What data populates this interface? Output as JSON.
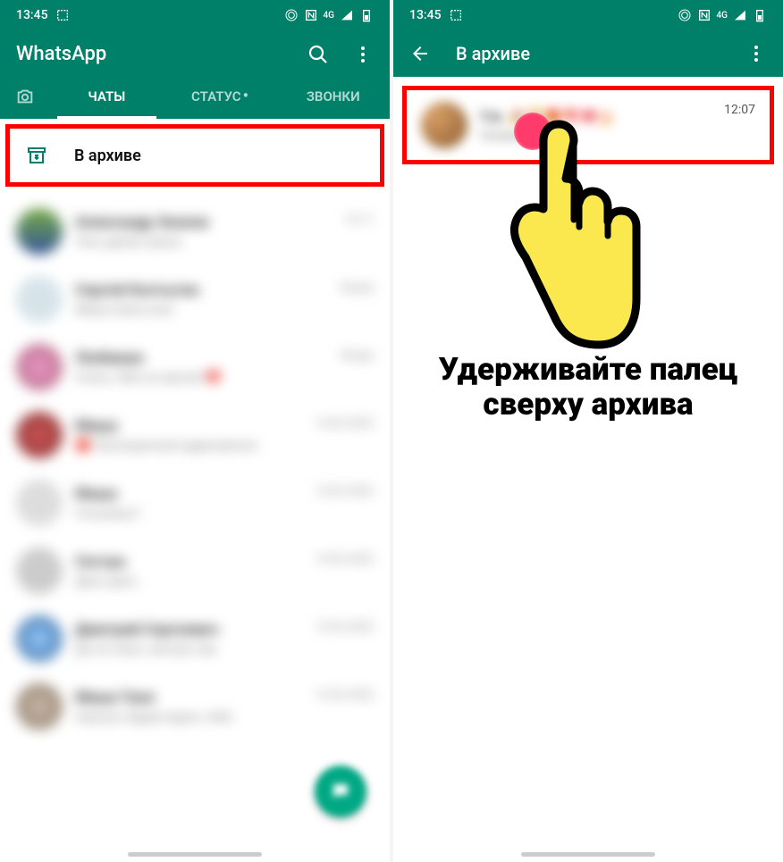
{
  "statusbar": {
    "time": "13:45",
    "indicators": "4G"
  },
  "left": {
    "app_title": "WhatsApp",
    "tabs": {
      "chats": "ЧАТЫ",
      "status": "СТАТУС",
      "calls": "ЗВОНКИ"
    },
    "archive_label": "В архиве"
  },
  "right": {
    "title": "В архиве",
    "chat_time": "12:07",
    "instruction_line1": "Удерживайте палец",
    "instruction_line2": "сверху архива"
  }
}
